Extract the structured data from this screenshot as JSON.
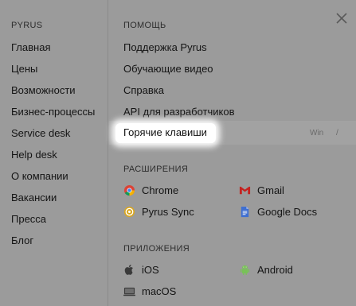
{
  "left": {
    "heading": "PYRUS",
    "items": [
      "Главная",
      "Цены",
      "Возможности",
      "Бизнес-процессы",
      "Service desk",
      "Help desk",
      "О компании",
      "Вакансии",
      "Пресса",
      "Блог"
    ]
  },
  "help": {
    "heading": "ПОМОЩЬ",
    "items": [
      "Поддержка Pyrus",
      "Обучающие видео",
      "Справка",
      "API для разработчиков",
      "Горячие клавиши"
    ],
    "shortcut_os": "Win",
    "shortcut_key": "/"
  },
  "extensions": {
    "heading": "РАСШИРЕНИЯ",
    "items": [
      {
        "label": "Chrome",
        "icon": "chrome-icon"
      },
      {
        "label": "Gmail",
        "icon": "gmail-icon"
      },
      {
        "label": "Pyrus Sync",
        "icon": "pyrus-sync-icon"
      },
      {
        "label": "Google Docs",
        "icon": "google-docs-icon"
      }
    ]
  },
  "apps": {
    "heading": "ПРИЛОЖЕНИЯ",
    "items": [
      {
        "label": "iOS",
        "icon": "apple-icon"
      },
      {
        "label": "Android",
        "icon": "android-icon"
      },
      {
        "label": "macOS",
        "icon": "macos-icon"
      }
    ]
  },
  "colors": {
    "background": "#9b9b9b",
    "highlight": "#ffffff"
  }
}
